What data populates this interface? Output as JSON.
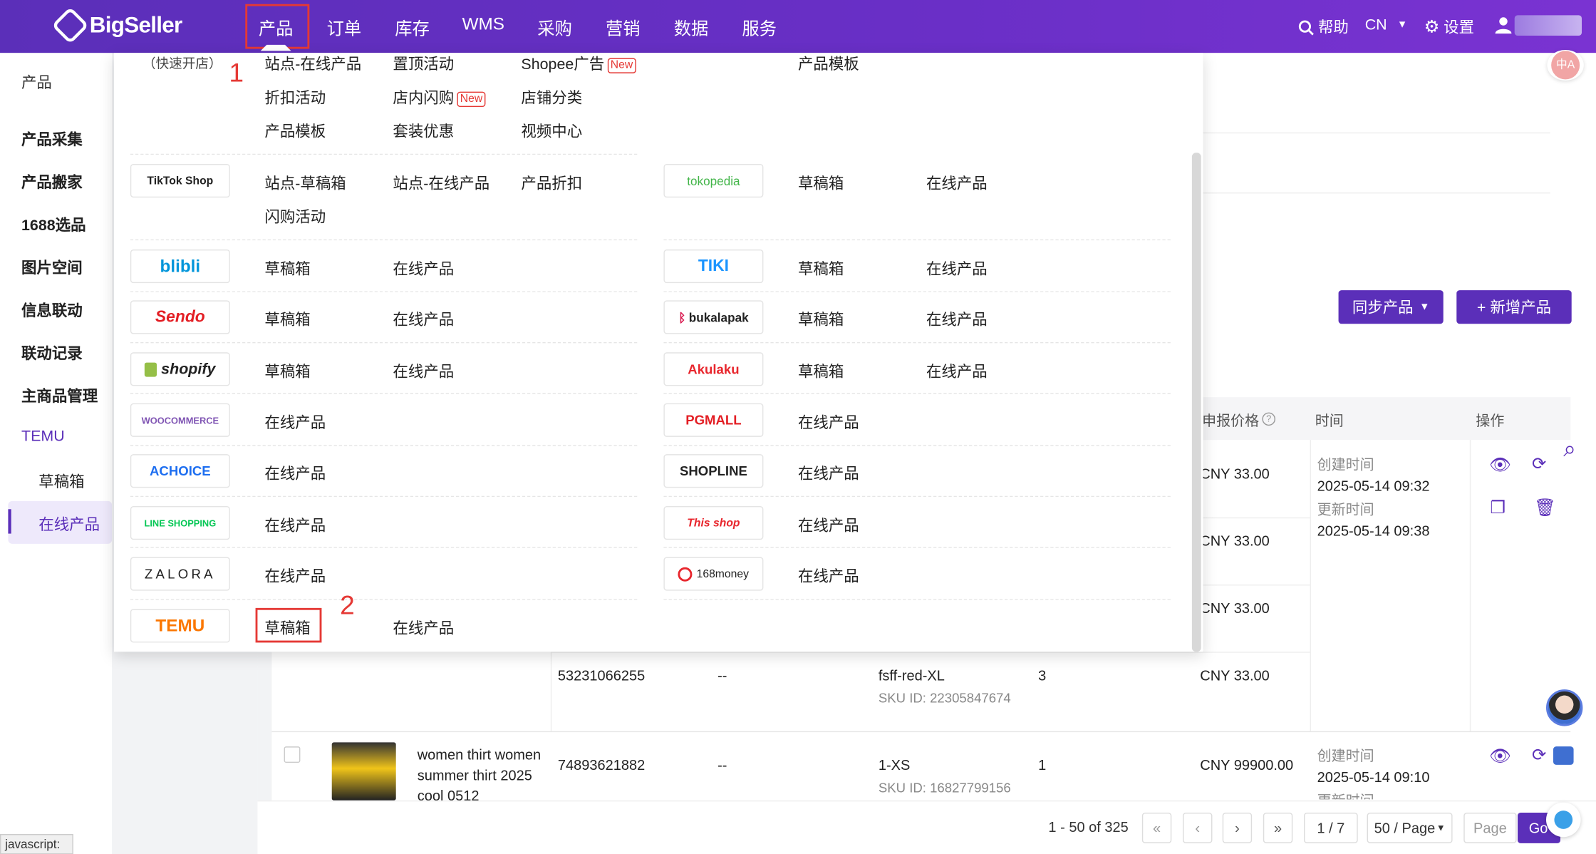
{
  "header": {
    "logo_text": "BigSeller",
    "nav": [
      "产品",
      "订单",
      "库存",
      "WMS",
      "采购",
      "营销",
      "数据",
      "服务"
    ],
    "help": "帮助",
    "lang": "CN",
    "settings": "设置"
  },
  "sidebar": {
    "title": "产品",
    "items": [
      "产品采集",
      "产品搬家",
      "1688选品",
      "图片空间",
      "信息联动",
      "联动记录",
      "主商品管理",
      "TEMU"
    ],
    "sub_items": [
      "草稿箱",
      "在线产品"
    ]
  },
  "annotations": {
    "step1": "1",
    "step2": "2"
  },
  "menu": {
    "top_partial": "（快速开店）",
    "shopee_rows": [
      [
        "站点-在线产品",
        "置顶活动",
        "Shopee广告",
        "产品模板"
      ],
      [
        "折扣活动",
        "店内闪购",
        "店铺分类"
      ],
      [
        "产品模板",
        "套装优惠",
        "视频中心"
      ]
    ],
    "new_tag": "New",
    "tiktok": {
      "logo": "TikTok Shop",
      "items": [
        "站点-草稿箱",
        "站点-在线产品",
        "产品折扣",
        "闪购活动"
      ]
    },
    "tokopedia": {
      "logo": "tokopedia",
      "items": [
        "草稿箱",
        "在线产品"
      ]
    },
    "blibli": {
      "logo": "blibli",
      "items": [
        "草稿箱",
        "在线产品"
      ]
    },
    "tiki": {
      "logo": "TIKI",
      "items": [
        "草稿箱",
        "在线产品"
      ]
    },
    "sendo": {
      "logo": "Sendo",
      "items": [
        "草稿箱",
        "在线产品"
      ]
    },
    "bukalapak": {
      "logo": "bukalapak",
      "items": [
        "草稿箱",
        "在线产品"
      ]
    },
    "shopify": {
      "logo": "shopify",
      "items": [
        "草稿箱",
        "在线产品"
      ]
    },
    "akulaku": {
      "logo": "Akulaku",
      "items": [
        "草稿箱",
        "在线产品"
      ]
    },
    "woocommerce": {
      "logo": "WOOCOMMERCE",
      "items": [
        "在线产品"
      ]
    },
    "pgmall": {
      "logo": "PGMALL",
      "items": [
        "在线产品"
      ]
    },
    "achoice": {
      "logo": "ACHOICE",
      "items": [
        "在线产品"
      ]
    },
    "shopline": {
      "logo": "SHOPLINE",
      "items": [
        "在线产品"
      ]
    },
    "lineshopping": {
      "logo": "LINE SHOPPING",
      "items": [
        "在线产品"
      ]
    },
    "thisshop": {
      "logo": "This shop",
      "items": [
        "在线产品"
      ]
    },
    "zalora": {
      "logo": "ZALORA",
      "items": [
        "在线产品"
      ]
    },
    "money168": {
      "logo": "168money",
      "items": [
        "在线产品"
      ]
    },
    "temu": {
      "logo": "TEMU",
      "items": [
        "草稿箱",
        "在线产品"
      ]
    }
  },
  "toolbar": {
    "sync": "同步产品",
    "add": "+ 新增产品"
  },
  "table": {
    "headers": [
      "申报价格",
      "时间",
      "操作"
    ],
    "prices": [
      "CNY 33.00",
      "CNY 33.00",
      "CNY 33.00"
    ],
    "row1_time": {
      "created_label": "创建时间",
      "created": "2025-05-14 09:32",
      "updated_label": "更新时间",
      "updated": "2025-05-14 09:38"
    },
    "row4": {
      "id": "53231066255",
      "dash": "--",
      "variant": "fsff-red-XL",
      "sku": "SKU ID: 22305847674",
      "qty": "3",
      "price": "CNY 33.00"
    },
    "row5": {
      "title": "women thirt women summer thirt 2025 cool 0512",
      "id": "74893621882",
      "dash": "--",
      "variant": "1-XS",
      "sku": "SKU ID: 16827799156",
      "qty": "1",
      "price": "CNY 99900.00",
      "created_label": "创建时间",
      "created": "2025-05-14 09:10",
      "updated_label": "更新时间"
    }
  },
  "pagination": {
    "range": "1 - 50 of 325",
    "page": "1 / 7",
    "per_page": "50 / Page",
    "page_placeholder": "Page",
    "go": "Go"
  },
  "status_bar": "javascript:"
}
